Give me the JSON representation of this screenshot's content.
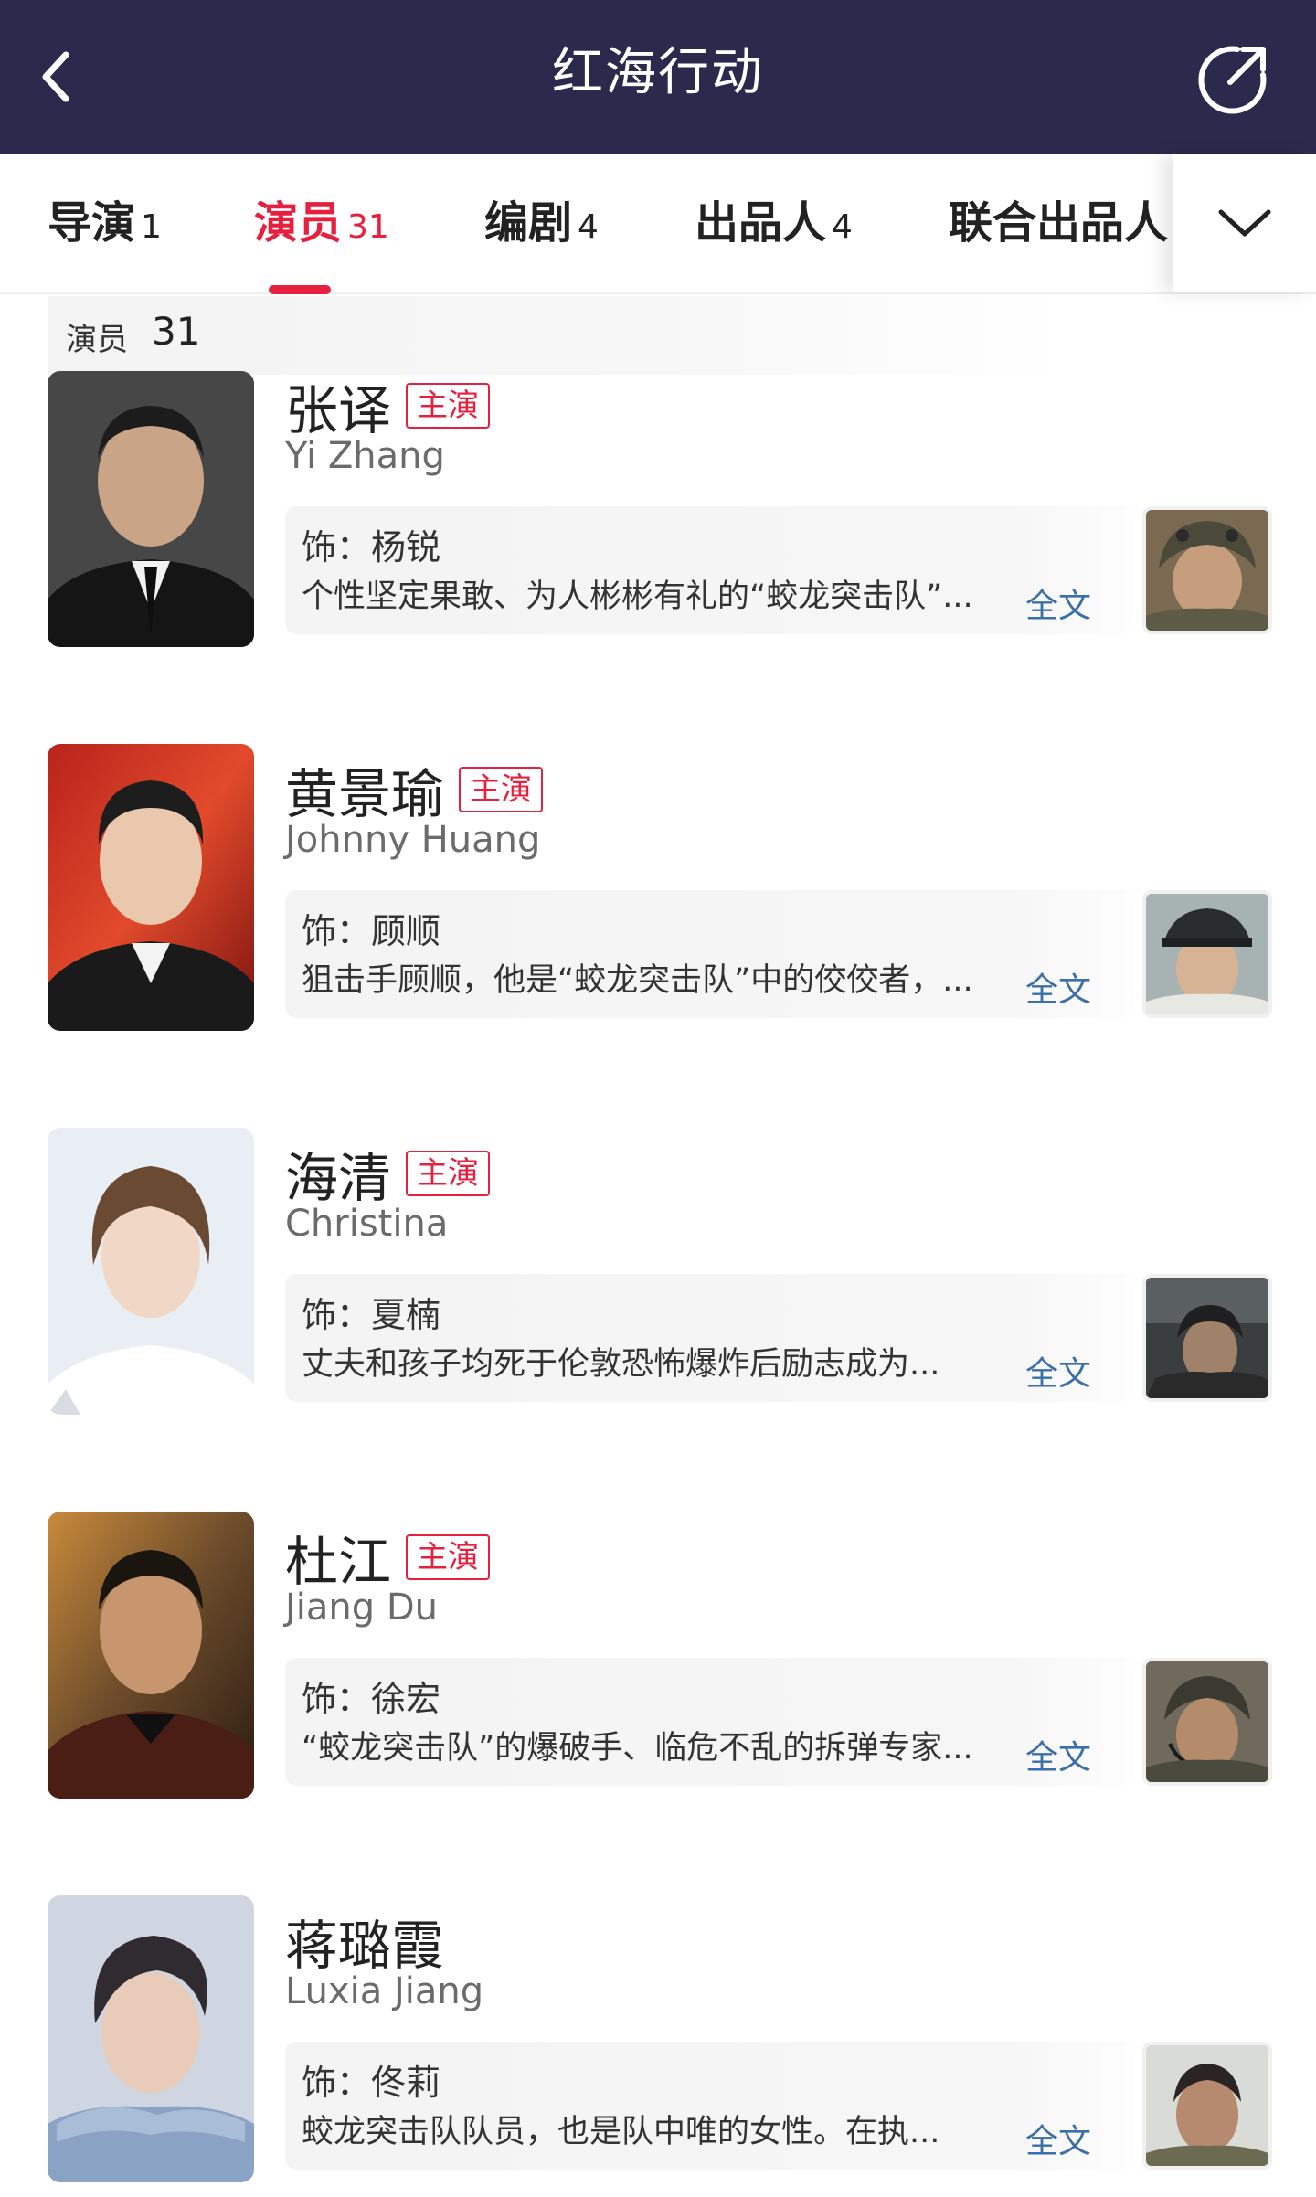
{
  "header": {
    "title": "红海行动",
    "back_icon": "chevron-left-icon",
    "share_icon": "share-icon"
  },
  "tabs": [
    {
      "label": "导演",
      "count": "1",
      "active": false
    },
    {
      "label": "演员",
      "count": "31",
      "active": true
    },
    {
      "label": "编剧",
      "count": "4",
      "active": false
    },
    {
      "label": "出品人",
      "count": "4",
      "active": false
    },
    {
      "label": "联合出品人",
      "count": "",
      "active": false
    }
  ],
  "tabs_more_icon": "chevron-down-icon",
  "section": {
    "label": "演员",
    "count": "31"
  },
  "actors": [
    {
      "name": "张译",
      "badge": "主演",
      "en_name": "Yi Zhang",
      "role": "饰：杨锐",
      "desc": "个性坚定果敢、为人彬彬有礼的“蛟龙突击队”...",
      "more": "全文"
    },
    {
      "name": "黄景瑜",
      "badge": "主演",
      "en_name": "Johnny Huang",
      "role": "饰：顾顺",
      "desc": "狙击手顾顺，他是“蛟龙突击队”中的佼佼者，...",
      "more": "全文"
    },
    {
      "name": "海清",
      "badge": "主演",
      "en_name": "Christina",
      "role": "饰：夏楠",
      "desc": "丈夫和孩子均死于伦敦恐怖爆炸后励志成为...",
      "more": "全文"
    },
    {
      "name": "杜江",
      "badge": "主演",
      "en_name": "Jiang Du",
      "role": "饰：徐宏",
      "desc": "“蛟龙突击队”的爆破手、临危不乱的拆弹专家...",
      "more": "全文"
    },
    {
      "name": "蒋璐霞",
      "badge": "",
      "en_name": "Luxia Jiang",
      "role": "饰：佟莉",
      "desc": "蛟龙突击队队员，也是队中唯的女性。在执...",
      "more": "全文"
    }
  ],
  "colors": {
    "header_bg": "#2b2a4c",
    "accent": "#e5213f",
    "link": "#3b6fa8"
  }
}
